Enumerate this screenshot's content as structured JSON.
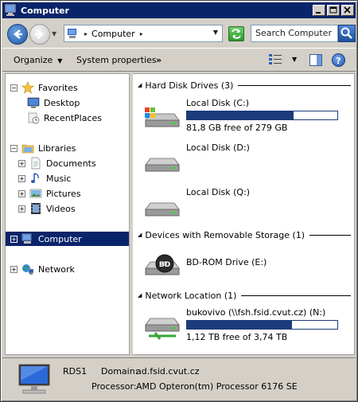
{
  "window": {
    "title": "Computer",
    "minimize": "_",
    "maximize": "□",
    "close": "✕"
  },
  "address": {
    "location": "Computer",
    "search_placeholder": "Search Computer"
  },
  "toolbar": {
    "organize": "Organize",
    "system_properties": "System properties",
    "more": "»"
  },
  "nav": {
    "favorites": {
      "label": "Favorites",
      "items": [
        {
          "label": "Desktop",
          "icon": "desktop-icon"
        },
        {
          "label": "RecentPlaces",
          "icon": "recent-places-icon"
        }
      ]
    },
    "libraries": {
      "label": "Libraries",
      "items": [
        {
          "label": "Documents",
          "icon": "documents-icon"
        },
        {
          "label": "Music",
          "icon": "music-icon"
        },
        {
          "label": "Pictures",
          "icon": "pictures-icon"
        },
        {
          "label": "Videos",
          "icon": "videos-icon"
        }
      ]
    },
    "computer": {
      "label": "Computer"
    },
    "network": {
      "label": "Network"
    }
  },
  "groups": {
    "hdd": {
      "title": "Hard Disk Drives (3)",
      "drives": [
        {
          "name": "Local Disk (C:)",
          "free": "81,8 GB free of 279 GB",
          "used_fraction": 0.707
        },
        {
          "name": "Local Disk (D:)"
        },
        {
          "name": "Local Disk (Q:)"
        }
      ]
    },
    "removable": {
      "title": "Devices with Removable Storage (1)",
      "drives": [
        {
          "name": "BD-ROM Drive (E:)",
          "badge": "BD"
        }
      ]
    },
    "network": {
      "title": "Network Location (1)",
      "drives": [
        {
          "name": "bukovivo (\\\\fsh.fsid.cvut.cz) (N:)",
          "free": "1,12 TB free of 3,74 TB",
          "used_fraction": 0.7
        }
      ]
    }
  },
  "details": {
    "name": "RDS1",
    "domain_label": "Domain:",
    "domain_value": "ad.fsid.cvut.cz",
    "processor_label": "Processor:",
    "processor_value": "AMD Opteron(tm) Processor 6176 SE"
  },
  "colors": {
    "titlebar": "#0a246a",
    "selection": "#0a246a",
    "drive_bar": "#1c3b7a"
  }
}
